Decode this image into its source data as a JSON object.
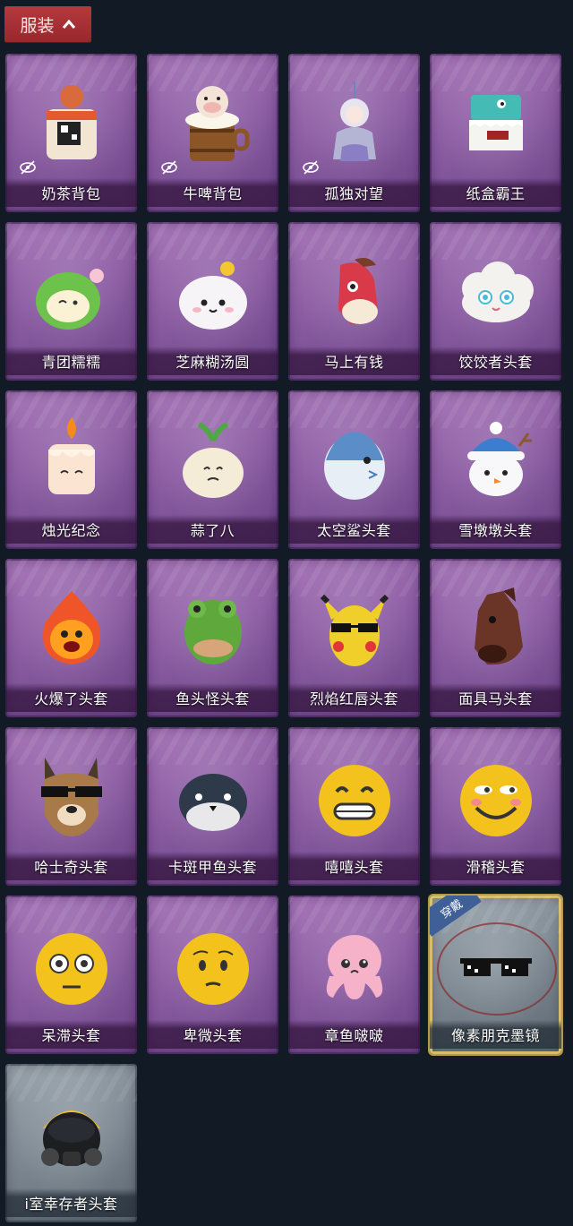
{
  "tab": {
    "label": "服装",
    "icon": "chevron-up-icon"
  },
  "items": [
    {
      "label": "奶茶背包",
      "icon": "milk-tea-backpack",
      "hidden": true
    },
    {
      "label": "牛啤背包",
      "icon": "beer-barrel-cow-backpack",
      "hidden": true
    },
    {
      "label": "孤独对望",
      "icon": "doll-charm",
      "hidden": true
    },
    {
      "label": "纸盒霸王",
      "icon": "cardboard-dino-head"
    },
    {
      "label": "青团糯糯",
      "icon": "green-dumpling-head"
    },
    {
      "label": "芝麻糊汤圆",
      "icon": "rice-ball-head"
    },
    {
      "label": "马上有钱",
      "icon": "red-horse-head"
    },
    {
      "label": "饺饺者头套",
      "icon": "cloud-dumpling-head"
    },
    {
      "label": "烛光纪念",
      "icon": "candle-head"
    },
    {
      "label": "蒜了八",
      "icon": "garlic-head"
    },
    {
      "label": "太空鲨头套",
      "icon": "space-shark-head"
    },
    {
      "label": "雪墩墩头套",
      "icon": "snowman-head"
    },
    {
      "label": "火爆了头套",
      "icon": "fireball-head"
    },
    {
      "label": "鱼头怪头套",
      "icon": "fish-monster-head"
    },
    {
      "label": "烈焰红唇头套",
      "icon": "yellow-mouse-head"
    },
    {
      "label": "面具马头套",
      "icon": "horse-mask-head"
    },
    {
      "label": "哈士奇头套",
      "icon": "husky-head"
    },
    {
      "label": "卡斑甲鱼头套",
      "icon": "whale-head"
    },
    {
      "label": "嘻嘻头套",
      "icon": "grin-emoji-head"
    },
    {
      "label": "滑稽头套",
      "icon": "funny-emoji-head"
    },
    {
      "label": "呆滞头套",
      "icon": "dazed-emoji-head"
    },
    {
      "label": "卑微头套",
      "icon": "humble-emoji-head"
    },
    {
      "label": "章鱼啵啵",
      "icon": "pink-octopus-head"
    },
    {
      "label": "像素朋克墨镜",
      "icon": "pixel-sunglasses",
      "equipped": true,
      "badge": "穿戴",
      "theme": "grey"
    },
    {
      "label": "i室幸存者头套",
      "icon": "gas-mask-helmet",
      "theme": "grey"
    }
  ],
  "colors": {
    "background": "#121a26",
    "tab": "#a83136",
    "card_purple": "#9466ab",
    "card_grey": "#7d8892",
    "equipped_border": "#d8bd6c"
  }
}
